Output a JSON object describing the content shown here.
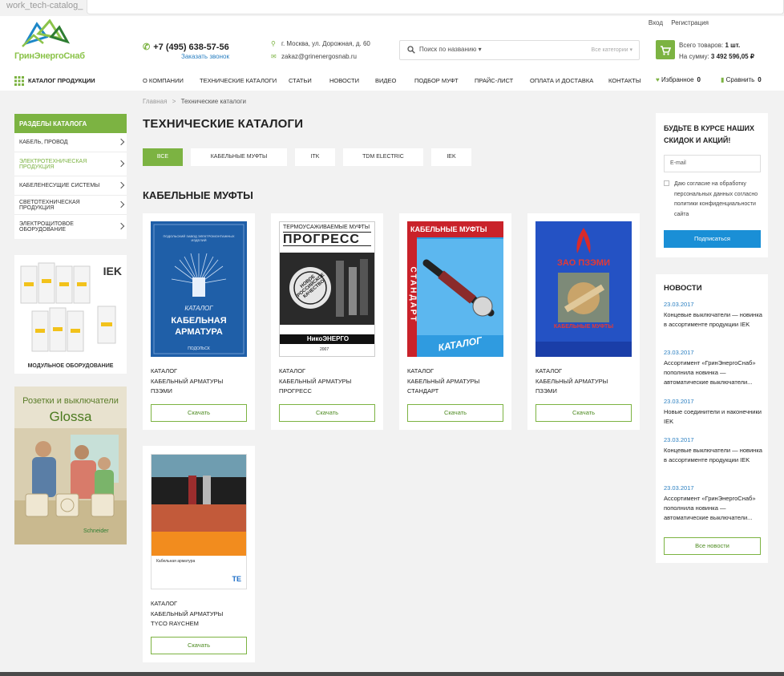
{
  "window": {
    "title": "work_tech-catalog_"
  },
  "header": {
    "auth": {
      "login": "Вход",
      "register": "Регистрация"
    },
    "logo_text": "ГринЭнергоСнаб",
    "phone": "+7 (495) 638-57-56",
    "callback": "Заказать звонок",
    "address": "г. Москва, ул. Дорожная, д. 60",
    "email": "zakaz@grinenergosnab.ru",
    "search": {
      "placeholder": "Поиск по названию",
      "category": "Все категории"
    },
    "cart": {
      "total_label": "Всего товаров:",
      "total_value": "1 шт.",
      "sum_label": "На сумму:",
      "sum_value": "3 492 596,05 ₽"
    }
  },
  "nav": {
    "catalog": "КАТАЛОГ ПРОДУКЦИИ",
    "items": [
      "О КОМПАНИИ",
      "ТЕХНИЧЕСКИЕ КАТАЛОГИ",
      "СТАТЬИ",
      "НОВОСТИ",
      "ВИДЕО",
      "ПОДБОР МУФТ",
      "ПРАЙС-ЛИСТ",
      "ОПЛАТА И ДОСТАВКА",
      "КОНТАКТЫ"
    ],
    "favorites_label": "Избранное",
    "favorites_count": "0",
    "compare_label": "Сравнить",
    "compare_count": "0"
  },
  "sidebar": {
    "sections_title": "РАЗДЕЛЫ КАТАЛОГА",
    "sections": [
      "КАБЕЛЬ, ПРОВОД",
      "ЭЛЕКТРОТЕХНИЧЕСКАЯ ПРОДУКЦИЯ",
      "КАБЕЛЕНЕСУЩИЕ СИСТЕМЫ",
      "СВЕТОТЕХНИЧЕСКАЯ ПРОДУКЦИЯ",
      "ЭЛЕКТРОЩИТОВОЕ ОБОРУДОВАНИЕ"
    ],
    "active_section": 1,
    "banner1": {
      "caption": "МОДУЛЬНОЕ ОБОРУДОВАНИЕ",
      "brand": "IEK"
    },
    "banner2": {
      "line1": "Розетки и выключатели",
      "line2": "Glossa",
      "brand": "Schneider Electric"
    }
  },
  "breadcrumb": {
    "home": "Главная",
    "sep": ">",
    "current": "Технические каталоги"
  },
  "page_title": "ТЕХНИЧЕСКИЕ КАТАЛОГИ",
  "filters": [
    "ВСЕ",
    "КАБЕЛЬНЫЕ МУФТЫ",
    "ITK",
    "TDM ELECTRIC",
    "IEK"
  ],
  "active_filter": 0,
  "section_title": "КАБЕЛЬНЫЕ МУФТЫ",
  "catalogs": [
    {
      "line1": "КАТАЛОГ",
      "line2": "КАБЕЛЬНЫЙ АРМАТУРЫ",
      "line3": "ПЗЭМИ",
      "button": "Скачать",
      "cover": {
        "top": "ПОДОЛЬСКИЙ ЗАВОД ЭЛЕКТРОМОНТАЖНЫХ ИЗДЕЛИЙ",
        "title1": "КАТАЛОГ",
        "title2": "КАБЕЛЬНАЯ",
        "title3": "АРМАТУРА",
        "bottom": "ПОДОЛЬСК"
      }
    },
    {
      "line1": "КАТАЛОГ",
      "line2": "КАБЕЛЬНЫЙ АРМАТУРЫ",
      "line3": "ПРОГРЕСС",
      "button": "Скачать",
      "cover": {
        "top": "ТЕРМОУСАЖИВАЕМЫЕ МУФТЫ",
        "title": "ПРОГРЕСС",
        "stamp": "НОВОЕ РОССИЙСКОЕ КАЧЕСТВО",
        "brand": "НикоЭНЕРГО",
        "year": "2007"
      }
    },
    {
      "line1": "КАТАЛОГ",
      "line2": "КАБЕЛЬНЫЙ АРМАТУРЫ",
      "line3": "СТАНДАРТ",
      "button": "Скачать",
      "cover": {
        "top": "КАБЕЛЬНЫЕ МУФТЫ",
        "side": "СТАНДАРТ",
        "title": "КАТАЛОГ"
      }
    },
    {
      "line1": "КАТАЛОГ",
      "line2": "КАБЕЛЬНЫЙ АРМАТУРЫ",
      "line3": "ПЗЭМИ",
      "button": "Скачать",
      "cover": {
        "title": "ЗАО ПЗЭМИ",
        "bottom": "КАБЕЛЬНЫЕ МУФТЫ"
      }
    },
    {
      "line1": "КАТАЛОГ",
      "line2": "КАБЕЛЬНЫЙ АРМАТУРЫ",
      "line3": "TYCO RAYCHEM",
      "button": "Скачать",
      "cover": {
        "caption": "Кабельная арматура",
        "brand": "TE"
      }
    }
  ],
  "subscribe": {
    "title": "БУДЬТЕ В КУРСЕ НАШИХ СКИДОК И АКЦИЙ!",
    "placeholder": "E-mail",
    "consent": "Даю согласие на обработку персональных данных согласно политики конфиденциальности сайта",
    "button": "Подписаться"
  },
  "news": {
    "title": "НОВОСТИ",
    "items": [
      {
        "date": "23.03.2017",
        "text": "Концевые выключатели — новинка в ассортименте продукции IEK"
      },
      {
        "date": "23.03.2017",
        "text": "Ассортимент «ГринЭнергоСнаб» пополнила новинка — автоматические выключатели..."
      },
      {
        "date": "23.03.2017",
        "text": "Новые соединители и наконечники IEK"
      },
      {
        "date": "23.03.2017",
        "text": "Концевые выключатели — новинка в ассортименте продукции IEK"
      },
      {
        "date": "23.03.2017",
        "text": "Ассортимент «ГринЭнергоСнаб» пополнила новинка — автоматические выключатели..."
      }
    ],
    "all_button": "Все новости"
  },
  "colors": {
    "accent": "#7cb342",
    "link": "#2a7fc1",
    "button_blue": "#1a8fd6"
  }
}
